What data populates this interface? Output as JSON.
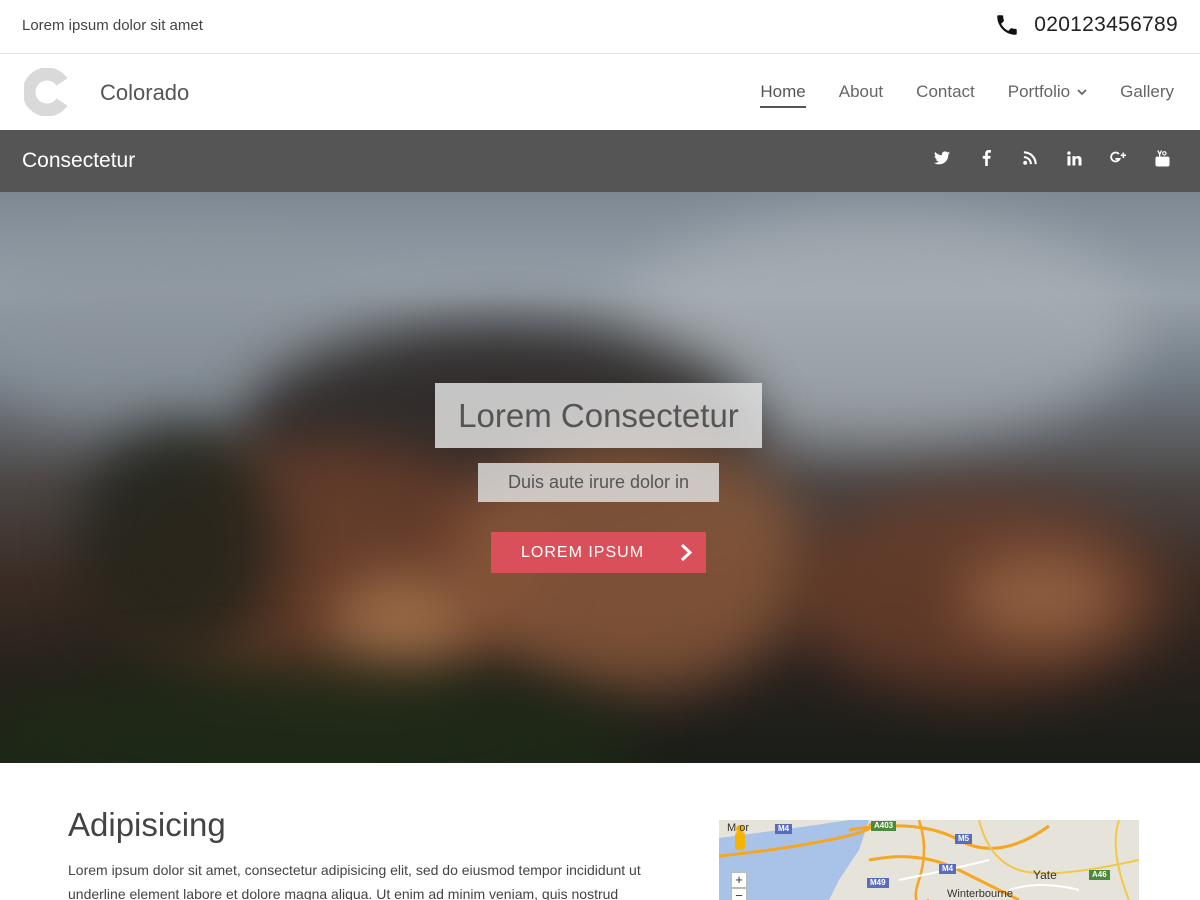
{
  "topbar": {
    "tagline": "Lorem ipsum dolor sit amet",
    "phone_number": "020123456789",
    "phone_icon": "phone-icon"
  },
  "header": {
    "logo_icon": "logo-c-icon",
    "site_title": "Colorado",
    "nav": [
      {
        "label": "Home",
        "active": true
      },
      {
        "label": "About",
        "active": false
      },
      {
        "label": "Contact",
        "active": false
      },
      {
        "label": "Portfolio",
        "active": false,
        "has_dropdown": true
      },
      {
        "label": "Gallery",
        "active": false
      }
    ]
  },
  "sectionbar": {
    "title": "Consectetur",
    "social": [
      "twitter-icon",
      "facebook-icon",
      "rss-icon",
      "linkedin-icon",
      "google-plus-icon",
      "youtube-icon"
    ]
  },
  "hero": {
    "title": "Lorem Consectetur",
    "subtitle": "Duis aute irure dolor in",
    "button_label": "LOREM IPSUM"
  },
  "content": {
    "heading": "Adipisicing",
    "text_before_link": "Lorem ipsum dolor sit amet, consectetur adipisicing elit, sed do eiusmod tempor incididunt ut ",
    "link_text": "underline element",
    "text_after_link": " labore et dolore magna aliqua. Ut enim ad minim veniam, quis nostrud exercitation ullamco"
  },
  "map": {
    "labels": {
      "yate": "Yate",
      "winterbourne": "Winterbourne",
      "partial_place": "M or"
    },
    "roads": {
      "m4_left": "M4",
      "a403": "A403",
      "m5": "M5",
      "m49": "M49",
      "m4_right": "M4",
      "a46": "A46"
    },
    "zoom_in": "+",
    "zoom_out": "−"
  },
  "colors": {
    "accent": "#d9505a",
    "sectionbar": "#555555"
  }
}
